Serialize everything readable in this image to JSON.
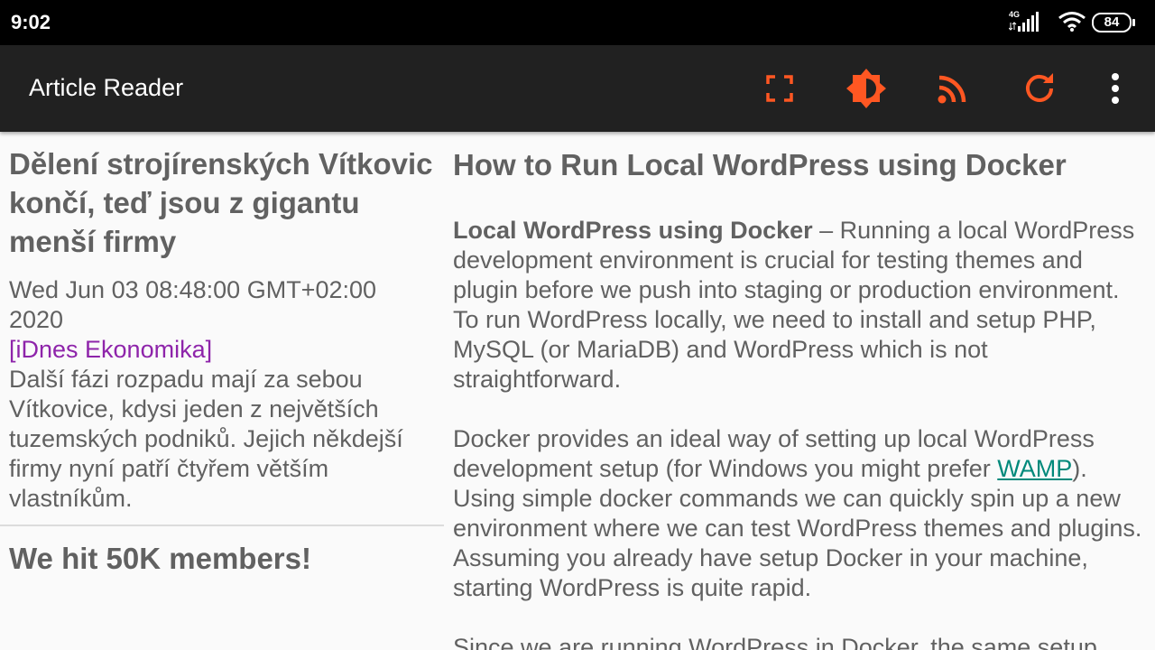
{
  "status_bar": {
    "time": "9:02",
    "network_label": "4G",
    "battery_level": "84",
    "icons": [
      "signal-icon",
      "wifi-icon",
      "battery-icon"
    ]
  },
  "toolbar": {
    "title": "Article Reader",
    "actions": [
      "fullscreen-icon",
      "brightness-icon",
      "rss-icon",
      "refresh-icon",
      "more-vert-icon"
    ],
    "accent_color": "#ff5722"
  },
  "article_list": [
    {
      "title": "Dělení strojírenských Vítkovic končí, teď jsou z gigantu menší firmy",
      "date": "Wed Jun 03 08:48:00 GMT+02:00 2020",
      "source": "[iDnes Ekonomika]",
      "summary": "Další fázi rozpadu mají za sebou Vítkovice, kdysi jeden z největších tuzemských podniků. Jejich někdejší firmy nyní patří čtyřem větším vlastníkům."
    },
    {
      "title": "We hit 50K members!"
    }
  ],
  "article": {
    "title": "How to Run Local WordPress using Docker",
    "p1_bold": "Local WordPress using Docker",
    "p1_rest": " – Running a local WordPress development environment is crucial for testing themes and plugin before we push into staging or production environment. To run WordPress locally, we need to install and setup PHP, MySQL (or MariaDB) and WordPress which is not straightforward.",
    "p2_before": "Docker provides an ideal way of setting up local WordPress development setup (for Windows you might prefer ",
    "p2_link": "WAMP",
    "p2_after": "). Using simple docker commands we can quickly spin up a new environment where we can test WordPress themes and plugins. Assuming you already have setup Docker in your machine, starting WordPress is quite rapid.",
    "p3": "Since we are running WordPress in Docker, the same setup"
  }
}
